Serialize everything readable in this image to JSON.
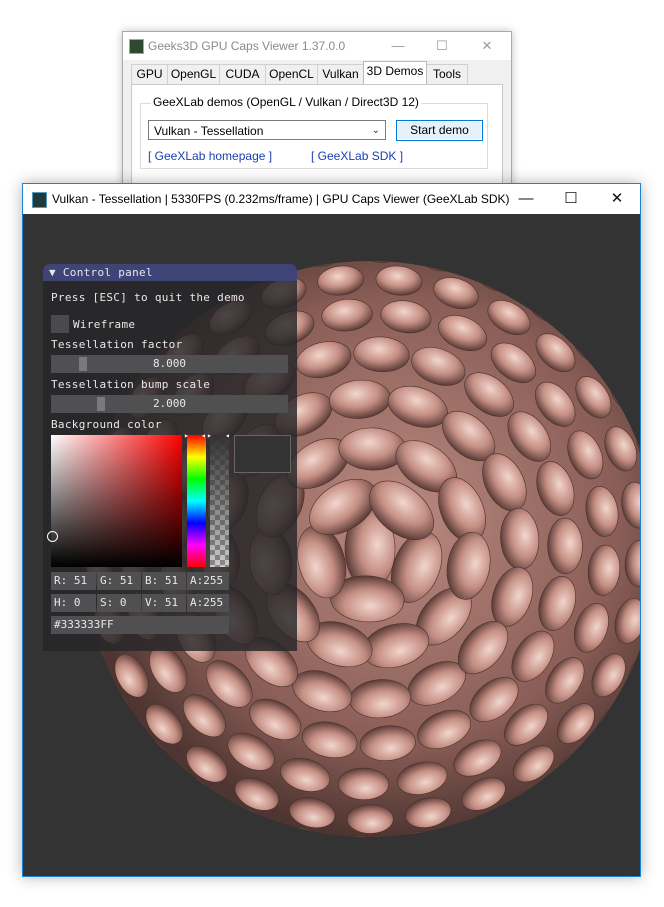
{
  "caps_window": {
    "title": "Geeks3D GPU Caps Viewer 1.37.0.0",
    "controls": {
      "minimize": "—",
      "maximize": "☐",
      "close": "✕"
    },
    "tabs": [
      "GPU",
      "OpenGL",
      "CUDA",
      "OpenCL",
      "Vulkan",
      "3D Demos",
      "Tools"
    ],
    "active_tab": "3D Demos",
    "group_label": "GeeXLab demos (OpenGL / Vulkan / Direct3D 12)",
    "demo_select": "Vulkan - Tessellation",
    "start_button": "Start demo",
    "link_homepage": "[ GeeXLab homepage ]",
    "link_sdk": "[ GeeXLab SDK ]"
  },
  "demo_window": {
    "title": "Vulkan - Tessellation | 5330FPS (0.232ms/frame) | GPU Caps Viewer (GeeXLab SDK)",
    "controls": {
      "minimize": "—",
      "maximize": "☐",
      "close": "✕"
    },
    "render_background": "#333333"
  },
  "control_panel": {
    "header": "▼ Control panel",
    "esc_hint": "Press [ESC] to quit the demo",
    "wireframe_label": "Wireframe",
    "tess_factor_label": "Tessellation factor",
    "tess_factor_value": "8.000",
    "tess_bump_label": "Tessellation bump scale",
    "tess_bump_value": "2.000",
    "bg_color_label": "Background color",
    "rgba": {
      "r": "R: 51",
      "g": "G: 51",
      "b": "B: 51",
      "a": "A:255"
    },
    "hsva": {
      "h": "H:  0",
      "s": "S:  0",
      "v": "V: 51",
      "a": "A:255"
    },
    "hex": "#333333FF"
  }
}
